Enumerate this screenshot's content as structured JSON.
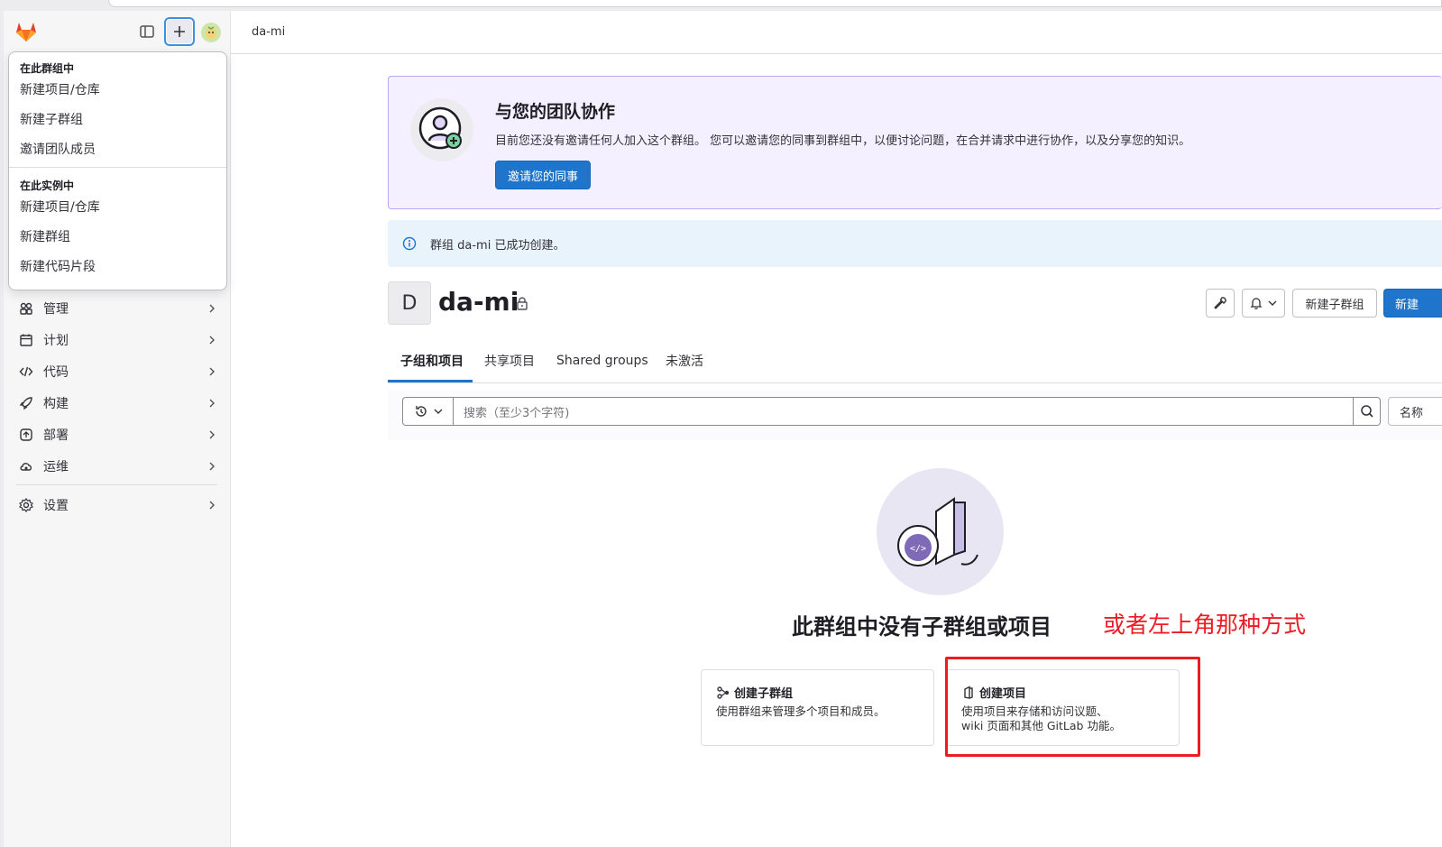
{
  "topbar": {
    "breadcrumb": "da-mi"
  },
  "sidebar": {
    "nav": [
      {
        "label": "管理",
        "icon": "users-icon"
      },
      {
        "label": "计划",
        "icon": "calendar-icon"
      },
      {
        "label": "代码",
        "icon": "code-icon"
      },
      {
        "label": "构建",
        "icon": "rocket-icon"
      },
      {
        "label": "部署",
        "icon": "deploy-icon"
      },
      {
        "label": "运维",
        "icon": "cloud-icon"
      }
    ],
    "settings_label": "设置"
  },
  "dropdown": {
    "group_heading": "在此群组中",
    "group_items": [
      "新建项目/仓库",
      "新建子群组",
      "邀请团队成员"
    ],
    "instance_heading": "在此实例中",
    "instance_items": [
      "新建项目/仓库",
      "新建群组",
      "新建代码片段"
    ]
  },
  "invite": {
    "title": "与您的团队协作",
    "description": "目前您还没有邀请任何人加入这个群组。 您可以邀请您的同事到群组中，以便讨论问题，在合并请求中进行协作，以及分享您的知识。",
    "button": "邀请您的同事"
  },
  "alert": {
    "text": "群组 da-mi 已成功创建。"
  },
  "group": {
    "avatar_letter": "D",
    "name": "da-mi",
    "new_subgroup_button": "新建子群组",
    "new_project_button": "新建"
  },
  "tabs": [
    "子组和项目",
    "共享项目",
    "Shared groups",
    "未激活"
  ],
  "filter": {
    "placeholder": "搜索（至少3个字符)",
    "sort_label": "名称"
  },
  "empty_state": {
    "title": "此群组中没有子群组或项目",
    "annotation": "或者左上角那种方式",
    "cards": [
      {
        "title": "创建子群组",
        "desc": [
          "使用群组来管理多个项目和成员。"
        ]
      },
      {
        "title": "创建项目",
        "desc": [
          "使用项目来存储和访问议题、",
          "wiki 页面和其他 GitLab 功能。"
        ]
      }
    ]
  },
  "colors": {
    "accent": "#1f75cb",
    "annotation": "#ec1c24",
    "invite_bg": "#f4f0ff"
  }
}
